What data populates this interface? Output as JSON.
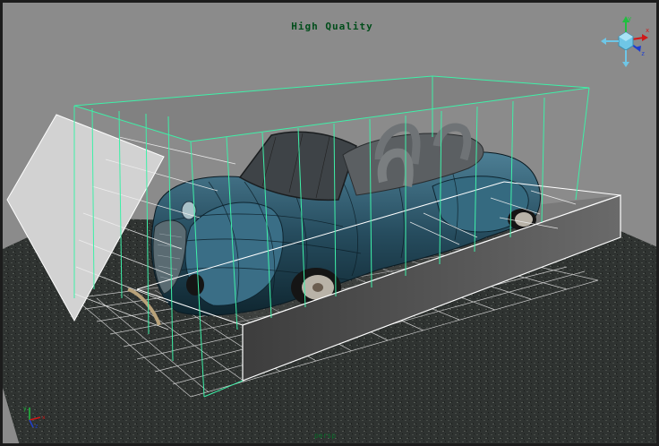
{
  "viewport": {
    "hud_title": "High Quality",
    "bottom_status": "persp",
    "background_color": "#8b8b8b",
    "wireframe_color": "#33e6a0",
    "selected_color": "#ffffff"
  },
  "viewcube": {
    "icon": "view-cube-icon",
    "axes": [
      {
        "label": "y",
        "color": "#1fbf3f"
      },
      {
        "label": "x",
        "color": "#d01818"
      },
      {
        "label": "z",
        "color": "#1f3fd0"
      }
    ]
  },
  "axis_gizmo": {
    "icon": "world-axis-icon",
    "labels": [
      "y",
      "x",
      "z"
    ]
  }
}
